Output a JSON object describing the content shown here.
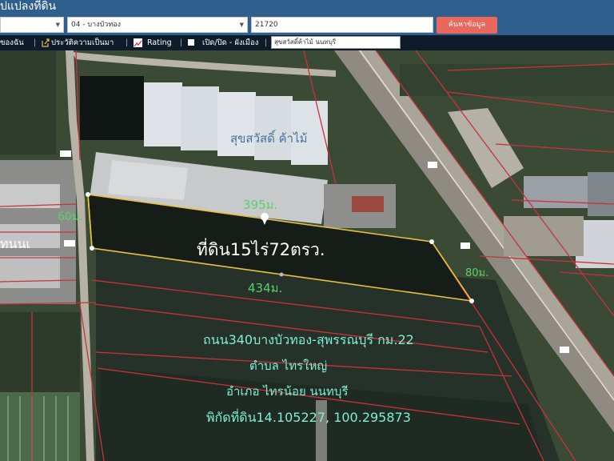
{
  "header": {
    "title": "ปแปลงที่ดิน",
    "select1": "",
    "select2": "04 - บางบัวทอง",
    "parcel_no": "21720",
    "search_button": "ค้นหาข้อมูล"
  },
  "toolbar": {
    "item1": "ของฉัน",
    "sep1": "|",
    "history": "ประวัติความเป็นมา",
    "sep2": "|",
    "rating": "Rating",
    "sep3": "|",
    "toggle_layer": "เปิด/ปิด - ผังเมือง",
    "sep4": "|",
    "label_input": "สุขสวัสดิ์ค้าไม้ นนทบุรี"
  },
  "map": {
    "label_business": "สุขสวัสดิ์ ค้าไม้",
    "dim_top": "395ม.",
    "dim_left": "60ม.",
    "dim_right": "80ม.",
    "dim_bottom": "434ม.",
    "area": "ที่ดิน15ไร่72ตรว.",
    "road": "ถนน340บางบัวทอง-สุพรรณบุรี กม.22",
    "subdistrict": "ตำบล ไทรใหญ่",
    "district": "อำเภอ ไทรน้อย นนทบุรี",
    "coords": "พิกัดที่ดิน14.105227, 100.295873",
    "left_fragment": "ทนนเ"
  },
  "colors": {
    "header_bg": "#2f5f8c",
    "toolbar_bg": "#0e1b2b",
    "search_button": "#e8685c",
    "parcel_outline": "#e8c23a",
    "parcel_lines": "#c8323c",
    "annotation_green": "#58d36a",
    "annotation_cyan": "#7ef0d4"
  },
  "icons": {
    "toolbar_history": "external-link-icon",
    "toolbar_rating": "chart-icon",
    "toolbar_toggle": "checkbox-icon",
    "map_marker": "location-pin-icon"
  }
}
